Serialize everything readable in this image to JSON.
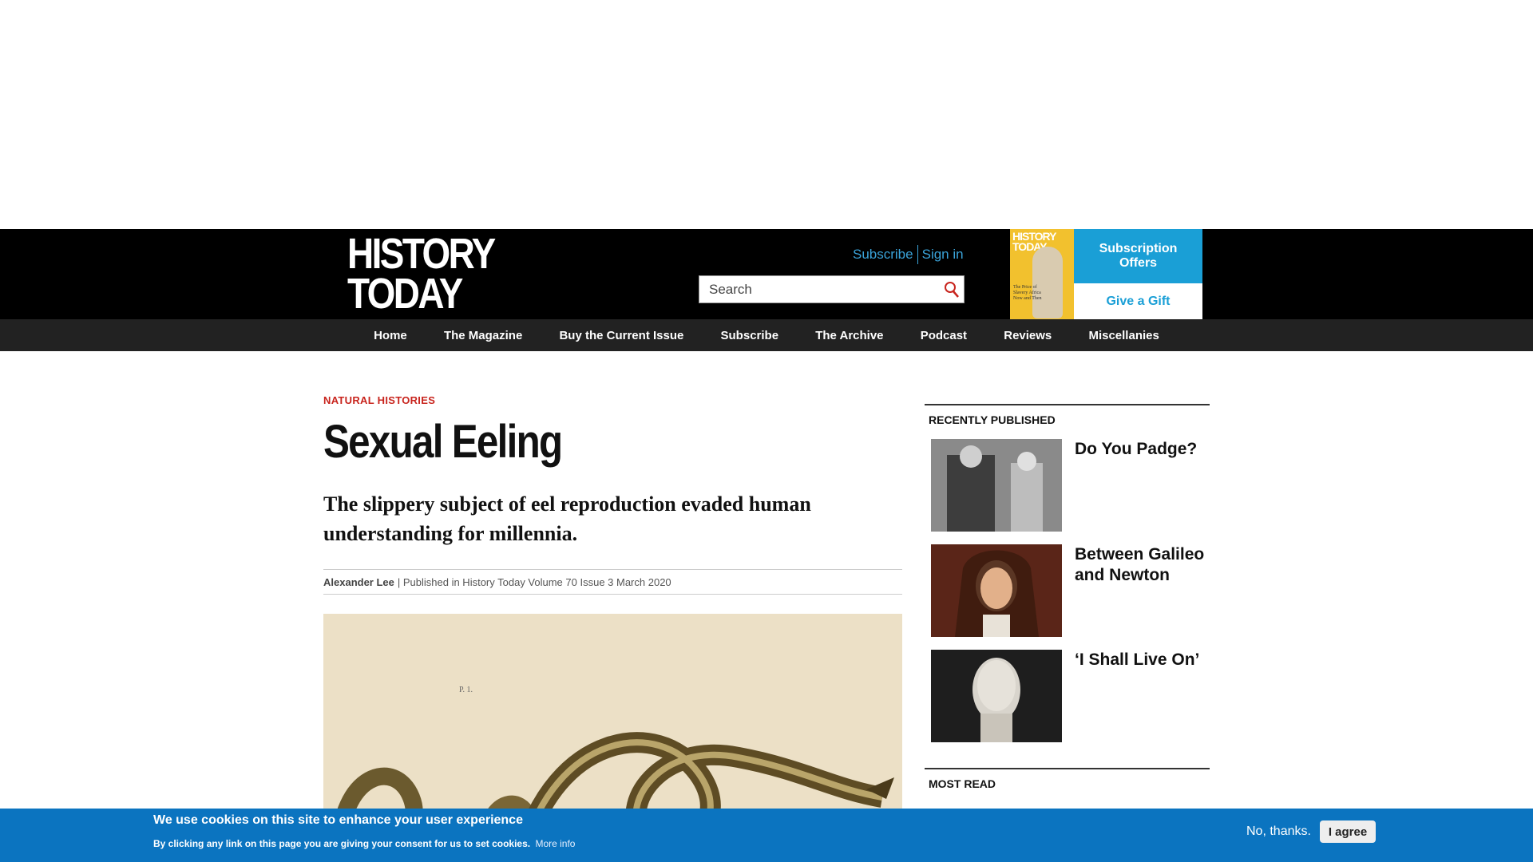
{
  "masthead": {
    "logo_line1": "HISTORY",
    "logo_line2": "TODAY",
    "subscribe_link": "Subscribe",
    "signin_link": "Sign in",
    "search_placeholder": "Search",
    "promo": {
      "cover_title_1": "HISTORY",
      "cover_title_2": "TODAY",
      "cover_text": "The Price of Slavery Africa Now and Then",
      "offers_label": "Subscription Offers",
      "gift_label": "Give a Gift"
    }
  },
  "nav": {
    "items": [
      "Home",
      "The Magazine",
      "Buy the Current Issue",
      "Subscribe",
      "The Archive",
      "Podcast",
      "Reviews",
      "Miscellanies"
    ]
  },
  "article": {
    "category": "NATURAL HISTORIES",
    "title": "Sexual Eeling",
    "standfirst": "The slippery subject of eel reproduction evaded human understanding for millennia.",
    "author": "Alexander Lee",
    "published": "| Published in History Today Volume 70 Issue 3 March 2020",
    "hero_plate_mark": "P. 1."
  },
  "sidebar": {
    "recent_heading": "RECENTLY PUBLISHED",
    "recent": [
      {
        "title": "Do You Padge?"
      },
      {
        "title": "Between Galileo and Newton"
      },
      {
        "title": "‘I Shall Live On’"
      }
    ],
    "most_read_heading": "MOST READ"
  },
  "cookie": {
    "title": "We use cookies on this site to enhance your user experience",
    "text": "By clicking any link on this page you are giving your consent for us to set cookies.",
    "more_info": "More info",
    "no_thanks": "No, thanks.",
    "agree": "I agree"
  },
  "colors": {
    "accent_blue": "#1a9fd6",
    "category_red": "#c8241d",
    "cookie_blue": "#0b74c0"
  }
}
